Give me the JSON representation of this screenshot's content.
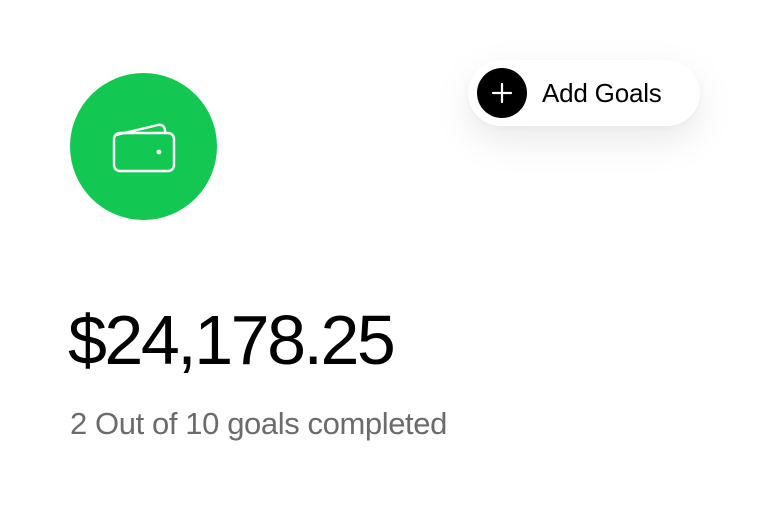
{
  "wallet": {
    "icon": "wallet-icon",
    "color": "#13c852"
  },
  "add_goals": {
    "icon": "plus-icon",
    "label": "Add Goals"
  },
  "summary": {
    "balance": "$24,178.25",
    "progress_text": "2 Out of 10 goals completed",
    "goals_completed": 2,
    "goals_total": 10
  }
}
